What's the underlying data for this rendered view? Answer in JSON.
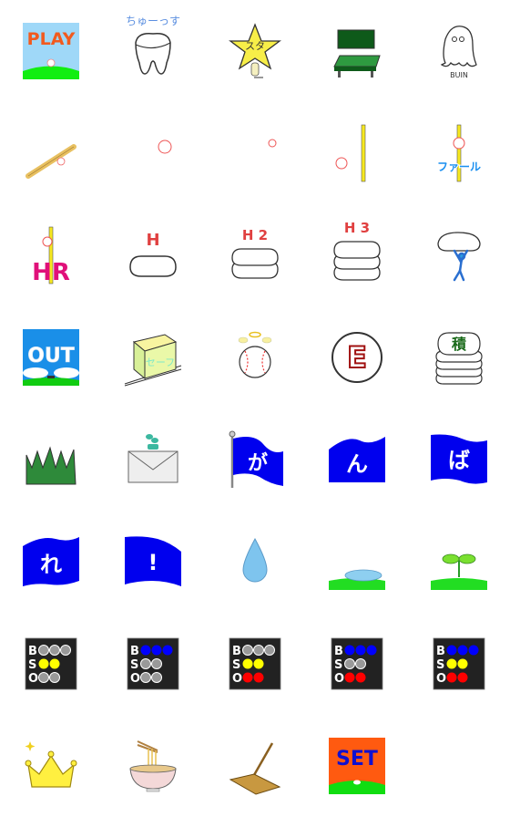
{
  "stickers": {
    "play": "PLAY",
    "chuussu": "ちゅーっす",
    "star": "スタ",
    "buin": "BUIN",
    "foul": "ファール",
    "hr": "HR",
    "h1": "H",
    "h2": "H 2",
    "h3": "H 3",
    "out": "OUT",
    "safe": "セーフ",
    "error": "E",
    "stack": "積",
    "flag_ga": "が",
    "flag_n": "ん",
    "flag_ba": "ば",
    "flag_re": "れ",
    "flag_excl": "!",
    "set": "SET"
  },
  "scoreboard_labels": {
    "b": "B",
    "s": "S",
    "o": "O"
  },
  "scoreboards": [
    {
      "balls": 0,
      "strikes": 2,
      "outs": 0
    },
    {
      "balls": 3,
      "strikes": 0,
      "outs": 0
    },
    {
      "balls": 0,
      "strikes": 2,
      "outs": 2
    },
    {
      "balls": 3,
      "strikes": 0,
      "outs": 2
    },
    {
      "balls": 3,
      "strikes": 2,
      "outs": 2
    }
  ],
  "colors": {
    "ball": "#0000ff",
    "strike": "#ffff00",
    "out": "#ff0000",
    "off": "#999999",
    "board": "#222222",
    "flag": "#0000ee",
    "grass": "#22dd22"
  }
}
